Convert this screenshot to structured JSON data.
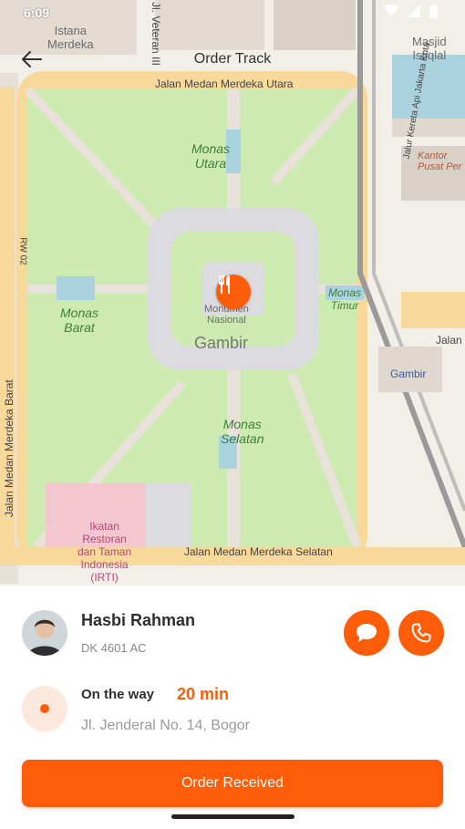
{
  "status_bar": {
    "time": "6:09",
    "icons": [
      "wifi-icon",
      "signal-icon",
      "battery-icon"
    ]
  },
  "app_bar": {
    "title": "Order Track",
    "back_icon": "arrow-left-icon"
  },
  "map": {
    "labels": {
      "istana": "Istana\nMerdeka",
      "masjid": "Masjid\nIstiqlal",
      "veteran": "Jl. Veteran III",
      "merdeka_utara": "Jalan Medan Merdeka Utara",
      "monas_utara": "Monas\nUtara",
      "monas_barat": "Monas\nBarat",
      "monas_timur": "Monas\nTimur",
      "monas_selatan": "Monas\nSelatan",
      "monumen": "Monumen\nNasional",
      "gambir": "Gambir",
      "gambir_station": "Gambir",
      "merdeka_barat": "Jalan Medan Merdeka Barat",
      "merdeka_selatan": "Jalan Medan Merdeka Selatan",
      "ikatan": "Ikatan\nRestoran\ndan Taman\nIndonesia\n(IRTI)",
      "kantor_pos": "Kantor\nPusat Per",
      "rail": "Jalur Kereta Api Jakarta Kota",
      "rw02": "RW 02",
      "jalan_right": "Jalan"
    },
    "marker_icon": "restaurant-icon"
  },
  "driver": {
    "name": "Hasbi Rahman",
    "plate": "DK 4601 AC",
    "chat_icon": "chat-icon",
    "call_icon": "phone-icon"
  },
  "delivery": {
    "status": "On the way",
    "eta": "20 min",
    "address": "Jl. Jenderal No. 14, Bogor"
  },
  "cta": {
    "label": "Order Received"
  },
  "colors": {
    "accent": "#fd5c08",
    "park": "#cdebb0",
    "road": "#f7d99b",
    "plaza": "#dcdce0"
  }
}
